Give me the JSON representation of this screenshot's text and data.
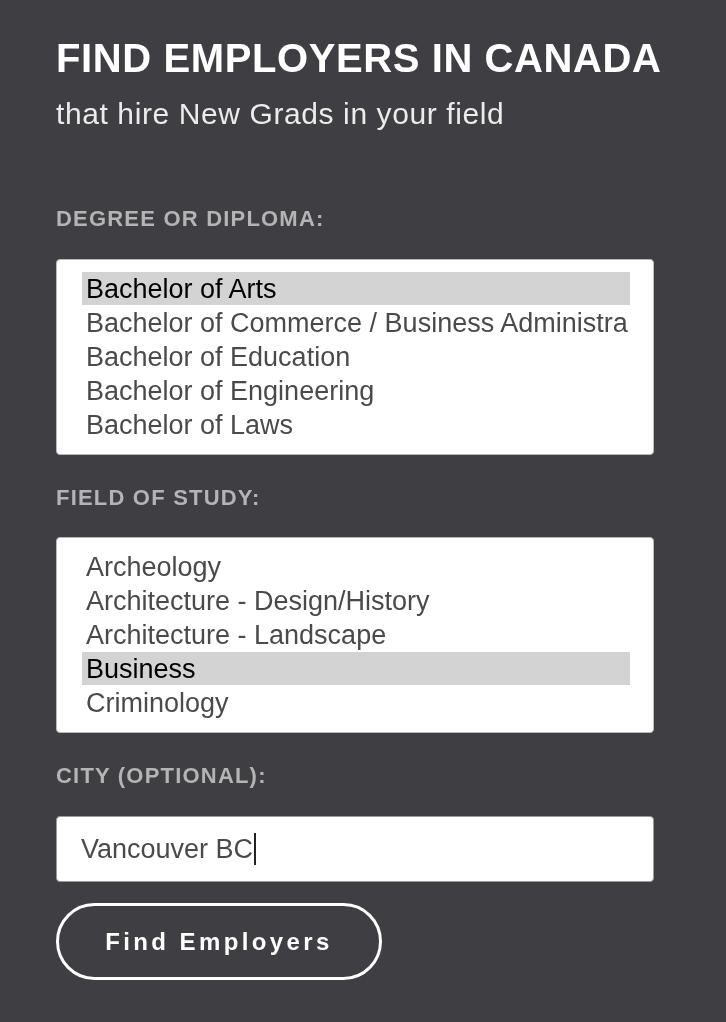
{
  "heading": {
    "title": "FIND EMPLOYERS IN CANADA",
    "subtitle": "that hire New Grads in your field"
  },
  "fields": [
    {
      "kind": "listbox",
      "label": "DEGREE OR DIPLOMA:",
      "options": [
        {
          "label": "Bachelor of Arts",
          "selected": true
        },
        {
          "label": "Bachelor of Commerce / Business Administra",
          "selected": false
        },
        {
          "label": "Bachelor of Education",
          "selected": false
        },
        {
          "label": "Bachelor of Engineering",
          "selected": false
        },
        {
          "label": "Bachelor of Laws",
          "selected": false
        }
      ]
    },
    {
      "kind": "listbox",
      "label": "FIELD OF STUDY:",
      "options": [
        {
          "label": "Archeology",
          "selected": false
        },
        {
          "label": "Architecture - Design/History",
          "selected": false
        },
        {
          "label": "Architecture - Landscape",
          "selected": false
        },
        {
          "label": "Business",
          "selected": true
        },
        {
          "label": "Criminology",
          "selected": false
        }
      ]
    },
    {
      "kind": "text",
      "label": "CITY (OPTIONAL):",
      "value": "Vancouver BC",
      "focused": true
    }
  ],
  "button": {
    "label": "Find Employers"
  }
}
